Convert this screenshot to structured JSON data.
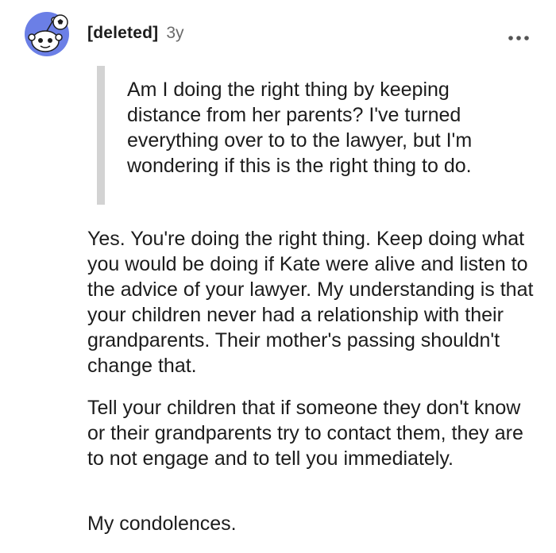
{
  "comment": {
    "author": "[deleted]",
    "age": "3y",
    "quote": "Am I doing the right thing by keeping distance from her parents? I've turned everything over to to the lawyer, but I'm wondering if this is the right thing to do.",
    "paragraphs": [
      "Yes. You're doing the right thing. Keep doing what you would be doing if Kate were alive and listen to the advice of your lawyer. My understanding is that your children never had a relationship with their grandparents. Their mother's passing shouldn't change that.",
      "Tell your children that if someone they don't know or their grandparents try to contact them, they are to not engage and to tell you immediately.",
      "My condolences."
    ]
  },
  "icons": {
    "avatar": "reddit-snoo-avatar-icon",
    "more": "more-options-icon"
  },
  "colors": {
    "avatar_bg": "#6b7fe6",
    "quote_bar": "#d3d3d3",
    "text": "#1c1c1c",
    "meta": "#6a6a6a"
  }
}
